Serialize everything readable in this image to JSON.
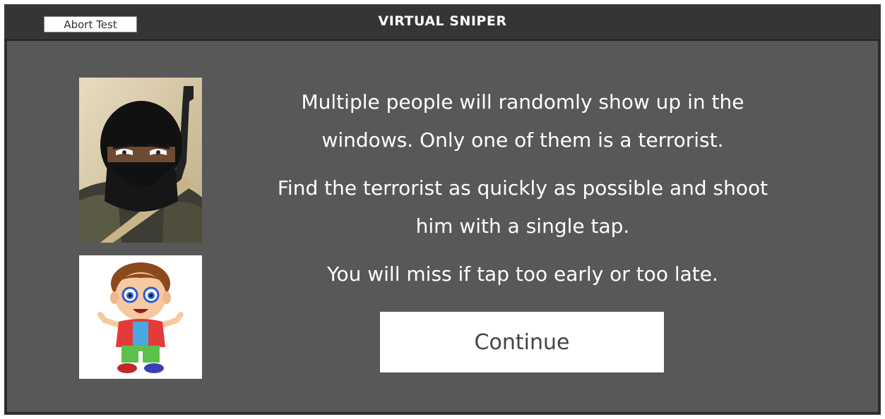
{
  "header": {
    "abort_label": "Abort Test",
    "title": "VIRTUAL SNIPER"
  },
  "instructions": {
    "line1": "Multiple people will randomly show up in the windows. Only one of them is a terrorist.",
    "line2": "Find the terrorist as quickly as possible and shoot him with a single tap.",
    "line3": "You will miss if tap too early or too late."
  },
  "images": {
    "terrorist": "terrorist-image",
    "civilian": "cartoon-boy-image"
  },
  "continue_label": "Continue",
  "colors": {
    "frame": "#2e2e2e",
    "titlebar": "#353535",
    "content_bg": "#585858",
    "text": "#ffffff",
    "button_bg": "#ffffff",
    "button_text": "#444444"
  }
}
